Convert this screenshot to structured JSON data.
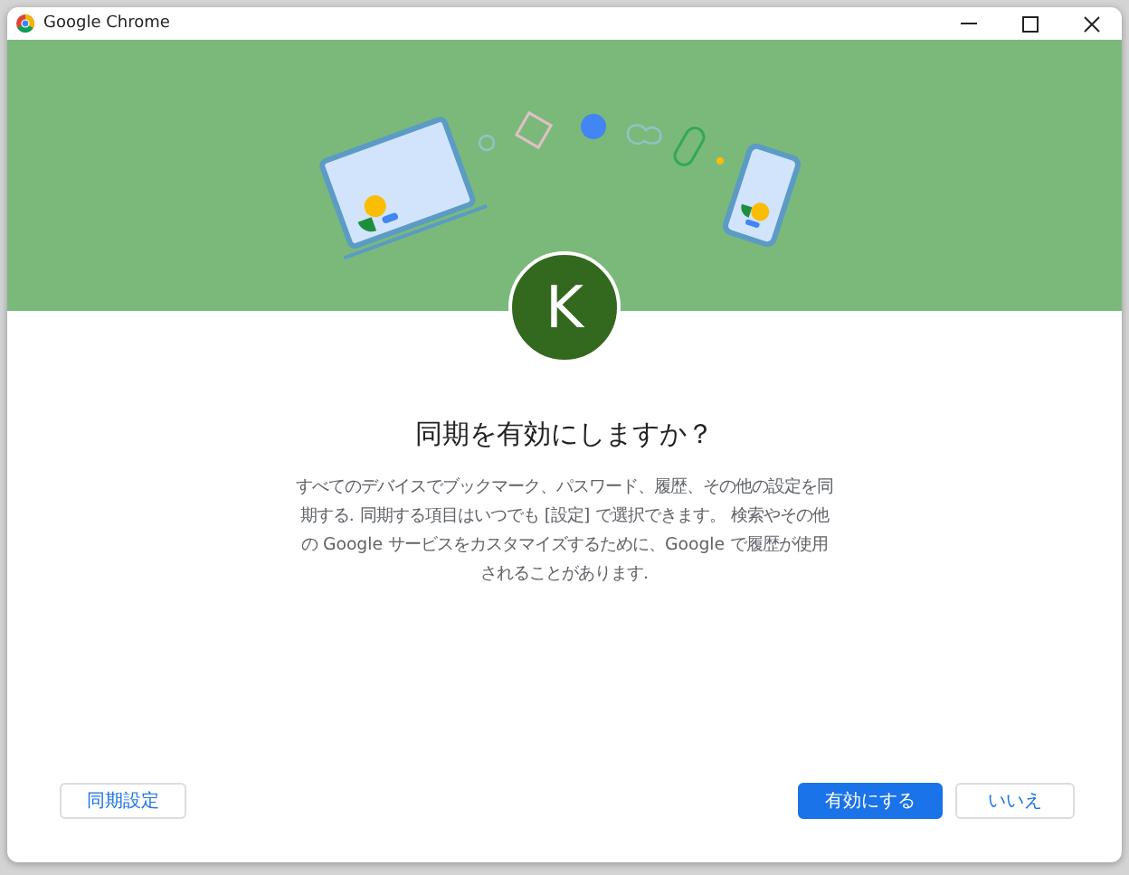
{
  "window": {
    "title": "Google Chrome"
  },
  "avatar": {
    "initial": "K"
  },
  "heading": "同期を有効にしますか？",
  "description": "すべてのデバイスでブックマーク、パスワード、履歴、その他の設定を同期する. 同期する項目はいつでも [設定] で選択できます。 検索やその他の Google サービスをカスタマイズするために、Google で履歴が使用されることがあります.",
  "buttons": [
    {
      "label": "同期設定",
      "kind": "secondary"
    },
    {
      "label": "有効にする",
      "kind": "primary"
    },
    {
      "label": "いいえ",
      "kind": "secondary"
    }
  ]
}
